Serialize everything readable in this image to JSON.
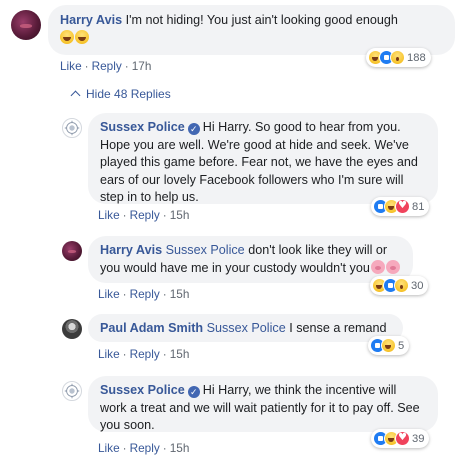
{
  "comments": [
    {
      "author": "Harry Avis",
      "text": "I'm not hiding! You just ain't looking good enough",
      "like": "Like",
      "reply": "Reply",
      "time": "17h",
      "reaction_count": "188",
      "reactions": [
        "haha",
        "like",
        "wow"
      ]
    }
  ],
  "hide_replies": {
    "label": "Hide 48 Replies",
    "icon": "chevron-up-icon"
  },
  "replies": [
    {
      "author": "Sussex Police",
      "verified": true,
      "text": "Hi Harry. So good to hear from you. Hope you are well. We're good at hide and seek. We've played this game before. Fear not, we have the eyes and ears of our lovely Facebook followers who I'm sure will step in to help us.",
      "like": "Like",
      "reply": "Reply",
      "time": "15h",
      "reaction_count": "81",
      "reactions": [
        "like",
        "haha",
        "love"
      ]
    },
    {
      "author": "Harry Avis",
      "tag": "Sussex Police",
      "text": "don't look like they will or you would have me in your custody wouldn't you",
      "like": "Like",
      "reply": "Reply",
      "time": "15h",
      "reaction_count": "30",
      "reactions": [
        "haha",
        "like",
        "wow"
      ]
    },
    {
      "author": "Paul Adam Smith",
      "tag": "Sussex Police",
      "text": "I sense a remand",
      "like": "Like",
      "reply": "Reply",
      "time": "15h",
      "reaction_count": "5",
      "reactions": [
        "like",
        "haha"
      ]
    },
    {
      "author": "Sussex Police",
      "verified": true,
      "text": "Hi Harry, we think the incentive will work a treat and we will wait patiently for it to pay off. See you soon.",
      "like": "Like",
      "reply": "Reply",
      "time": "15h",
      "reaction_count": "39",
      "reactions": [
        "like",
        "haha",
        "love"
      ]
    }
  ],
  "colors": {
    "link": "#385898",
    "bubble": "#f2f3f5",
    "meta": "#606770",
    "like_blue": "#1f7cf2",
    "love_red": "#f0435c",
    "haha_yellow": "#f7c42c"
  }
}
